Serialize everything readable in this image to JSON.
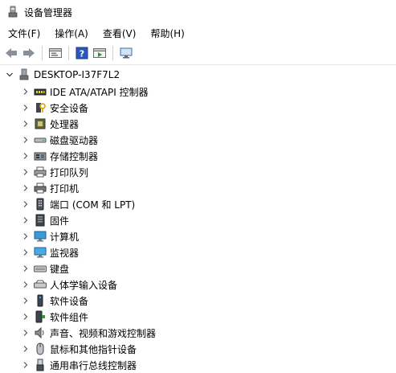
{
  "window": {
    "title": "设备管理器"
  },
  "menu": [
    "文件(F)",
    "操作(A)",
    "查看(V)",
    "帮助(H)"
  ],
  "toolbar": {
    "buttons": [
      "back-icon",
      "forward-icon",
      "properties-icon",
      "help-icon",
      "update-driver-icon",
      "monitor-scan-icon"
    ]
  },
  "tree": {
    "root": "DESKTOP-I37F7L2",
    "items": [
      {
        "label": "IDE ATA/ATAPI 控制器",
        "icon": "ide-controller-icon"
      },
      {
        "label": "安全设备",
        "icon": "security-device-icon"
      },
      {
        "label": "处理器",
        "icon": "processor-icon"
      },
      {
        "label": "磁盘驱动器",
        "icon": "disk-drive-icon"
      },
      {
        "label": "存储控制器",
        "icon": "storage-controller-icon"
      },
      {
        "label": "打印队列",
        "icon": "print-queue-icon"
      },
      {
        "label": "打印机",
        "icon": "printer-icon"
      },
      {
        "label": "端口 (COM 和 LPT)",
        "icon": "port-icon"
      },
      {
        "label": "固件",
        "icon": "firmware-icon"
      },
      {
        "label": "计算机",
        "icon": "computer-icon"
      },
      {
        "label": "监视器",
        "icon": "monitor-icon"
      },
      {
        "label": "键盘",
        "icon": "keyboard-icon"
      },
      {
        "label": "人体学输入设备",
        "icon": "hid-icon"
      },
      {
        "label": "软件设备",
        "icon": "software-device-icon"
      },
      {
        "label": "软件组件",
        "icon": "software-component-icon"
      },
      {
        "label": "声音、视频和游戏控制器",
        "icon": "sound-icon"
      },
      {
        "label": "鼠标和其他指针设备",
        "icon": "mouse-icon"
      },
      {
        "label": "通用串行总线控制器",
        "icon": "usb-icon"
      }
    ]
  }
}
